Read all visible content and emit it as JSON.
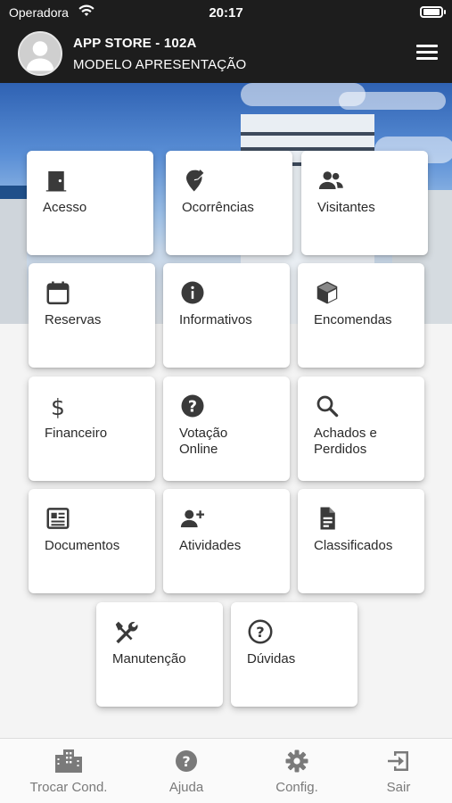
{
  "status_bar": {
    "carrier": "Operadora",
    "time": "20:17"
  },
  "header": {
    "title": "APP STORE - 102A",
    "subtitle": "MODELO APRESENTAÇÃO"
  },
  "tiles": [
    {
      "label": "Acesso",
      "icon": "door-icon"
    },
    {
      "label": "Ocorrências",
      "icon": "edit-pin-icon"
    },
    {
      "label": "Visitantes",
      "icon": "people-icon"
    },
    {
      "label": "Reservas",
      "icon": "calendar-icon"
    },
    {
      "label": "Informativos",
      "icon": "info-icon"
    },
    {
      "label": "Encomendas",
      "icon": "package-icon"
    },
    {
      "label": "Financeiro",
      "icon": "dollar-icon"
    },
    {
      "label": "Votação Online",
      "icon": "question-icon"
    },
    {
      "label": "Achados e Perdidos",
      "icon": "search-icon"
    },
    {
      "label": "Documentos",
      "icon": "newspaper-icon"
    },
    {
      "label": "Atividades",
      "icon": "person-add-icon"
    },
    {
      "label": "Classificados",
      "icon": "file-icon"
    },
    {
      "label": "Manutenção",
      "icon": "tools-icon"
    },
    {
      "label": "Dúvidas",
      "icon": "help-circle-icon"
    }
  ],
  "bottom_nav": [
    {
      "label": "Trocar Cond.",
      "icon": "buildings-icon"
    },
    {
      "label": "Ajuda",
      "icon": "question-icon"
    },
    {
      "label": "Config.",
      "icon": "gear-icon"
    },
    {
      "label": "Sair",
      "icon": "logout-icon"
    }
  ],
  "colors": {
    "header_bg": "#1d1d1d",
    "tile_bg": "#ffffff",
    "icon": "#3a3a3a",
    "nav_text": "#7a7a7a"
  }
}
